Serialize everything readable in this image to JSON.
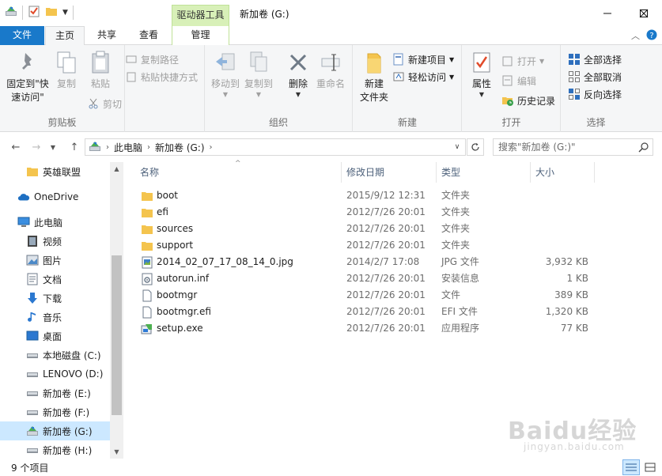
{
  "titlebar": {
    "context_tab_group": "驱动器工具",
    "window_title": "新加卷 (G:)"
  },
  "tabs": {
    "file": "文件",
    "home": "主页",
    "share": "共享",
    "view": "查看",
    "manage": "管理"
  },
  "ribbon": {
    "clipboard": {
      "label": "剪贴板",
      "pin": "固定到\"快速访问\"",
      "copy": "复制",
      "paste": "粘贴",
      "copy_path": "复制路径",
      "paste_shortcut": "粘贴快捷方式",
      "cut": "剪切"
    },
    "organize": {
      "label": "组织",
      "move_to": "移动到",
      "copy_to": "复制到",
      "delete": "删除",
      "rename": "重命名"
    },
    "new": {
      "label": "新建",
      "new_folder": "新建\n文件夹",
      "new_item": "新建项目",
      "easy_access": "轻松访问"
    },
    "open": {
      "label": "打开",
      "properties": "属性",
      "open": "打开",
      "edit": "编辑",
      "history": "历史记录"
    },
    "select": {
      "label": "选择",
      "select_all": "全部选择",
      "select_none": "全部取消",
      "invert": "反向选择"
    }
  },
  "address": {
    "crumbs": [
      "此电脑",
      "新加卷 (G:)"
    ],
    "search_placeholder": "搜索\"新加卷 (G:)\""
  },
  "navpane": {
    "items": [
      {
        "label": "英雄联盟",
        "icon": "folder-icon"
      },
      {
        "label": "OneDrive",
        "icon": "onedrive-icon"
      },
      {
        "label": "此电脑",
        "icon": "pc-icon"
      },
      {
        "label": "视频",
        "icon": "video-icon"
      },
      {
        "label": "图片",
        "icon": "pictures-icon"
      },
      {
        "label": "文档",
        "icon": "documents-icon"
      },
      {
        "label": "下载",
        "icon": "download-icon"
      },
      {
        "label": "音乐",
        "icon": "music-icon"
      },
      {
        "label": "桌面",
        "icon": "desktop-icon"
      },
      {
        "label": "本地磁盘 (C:)",
        "icon": "drive-icon"
      },
      {
        "label": "LENOVO (D:)",
        "icon": "drive-icon"
      },
      {
        "label": "新加卷 (E:)",
        "icon": "drive-icon"
      },
      {
        "label": "新加卷 (F:)",
        "icon": "drive-icon"
      },
      {
        "label": "新加卷 (G:)",
        "icon": "drive-g-icon"
      },
      {
        "label": "新加卷 (H:)",
        "icon": "drive-icon"
      }
    ]
  },
  "filelist": {
    "columns": {
      "name": "名称",
      "date": "修改日期",
      "type": "类型",
      "size": "大小"
    },
    "rows": [
      {
        "name": "boot",
        "date": "2015/9/12 12:31",
        "type": "文件夹",
        "size": "",
        "icon": "folder-icon"
      },
      {
        "name": "efi",
        "date": "2012/7/26 20:01",
        "type": "文件夹",
        "size": "",
        "icon": "folder-icon"
      },
      {
        "name": "sources",
        "date": "2012/7/26 20:01",
        "type": "文件夹",
        "size": "",
        "icon": "folder-icon"
      },
      {
        "name": "support",
        "date": "2012/7/26 20:01",
        "type": "文件夹",
        "size": "",
        "icon": "folder-icon"
      },
      {
        "name": "2014_02_07_17_08_14_0.jpg",
        "date": "2014/2/7 17:08",
        "type": "JPG 文件",
        "size": "3,932 KB",
        "icon": "image-file-icon"
      },
      {
        "name": "autorun.inf",
        "date": "2012/7/26 20:01",
        "type": "安装信息",
        "size": "1 KB",
        "icon": "setup-info-icon"
      },
      {
        "name": "bootmgr",
        "date": "2012/7/26 20:01",
        "type": "文件",
        "size": "389 KB",
        "icon": "file-icon"
      },
      {
        "name": "bootmgr.efi",
        "date": "2012/7/26 20:01",
        "type": "EFI 文件",
        "size": "1,320 KB",
        "icon": "file-icon"
      },
      {
        "name": "setup.exe",
        "date": "2012/7/26 20:01",
        "type": "应用程序",
        "size": "77 KB",
        "icon": "exe-icon"
      }
    ]
  },
  "status": {
    "item_count": "9 个项目"
  },
  "watermark": {
    "logo": "Baidu经验",
    "url": "jingyan.baidu.com"
  },
  "colors": {
    "file_tab": "#1979ca",
    "manage_band": "#d8f0b8",
    "selection": "#cce8ff",
    "folder": "#f4c44e"
  }
}
